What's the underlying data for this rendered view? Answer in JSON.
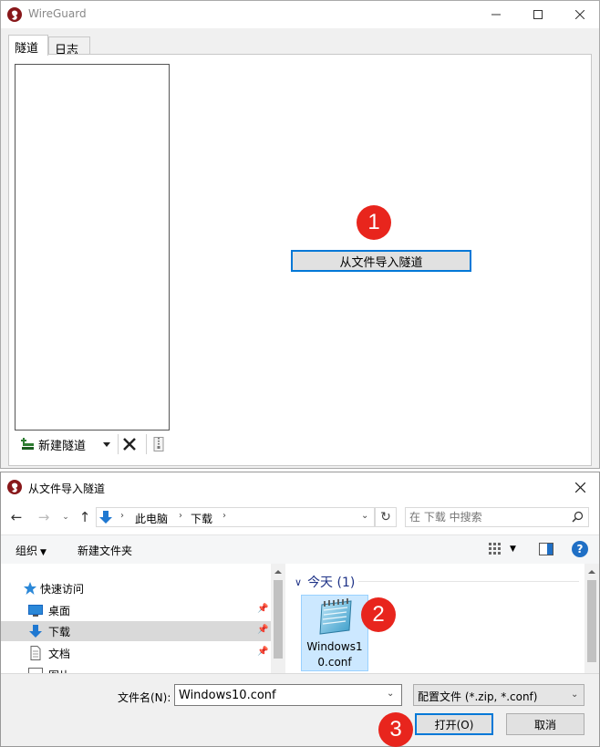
{
  "wireguard": {
    "title": "WireGuard",
    "tabs": {
      "tunnels": "隧道",
      "log": "日志"
    },
    "new_tunnel_label": "新建隧道",
    "import_button_label": "从文件导入隧道"
  },
  "steps": {
    "one": "1",
    "two": "2",
    "three": "3"
  },
  "dialog": {
    "title": "从文件导入隧道",
    "breadcrumb": [
      "此电脑",
      "下载"
    ],
    "search_placeholder": "在 下载 中搜索",
    "organize_label": "组织",
    "new_folder_label": "新建文件夹",
    "nav_items": {
      "quick_access": "快速访问",
      "desktop": "桌面",
      "downloads": "下载",
      "documents": "文档",
      "pictures": "图片"
    },
    "group_header": "今天 (1)",
    "file": {
      "name": "Windows10.conf"
    },
    "filename_label": "文件名(N):",
    "filename_value": "Windows10.conf",
    "filter_value": "配置文件 (*.zip, *.conf)",
    "open_label": "打开(O)",
    "cancel_label": "取消"
  },
  "colors": {
    "accent": "#0078d7",
    "badge": "#e8251d",
    "group_header": "#1e3287",
    "selection": "#cce8ff"
  }
}
